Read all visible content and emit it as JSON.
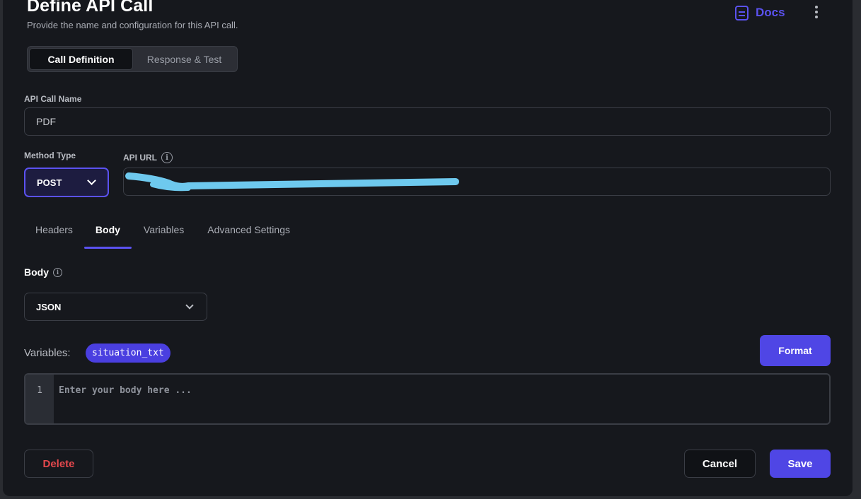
{
  "header": {
    "title": "Define API Call",
    "subtitle": "Provide the name and configuration for this API call.",
    "docs_label": "Docs",
    "docs_icon": "document-icon",
    "menu_icon": "kebab-menu-icon"
  },
  "segmented": {
    "tabs": [
      "Call Definition",
      "Response & Test"
    ],
    "active": "Call Definition"
  },
  "form": {
    "api_call_name": {
      "label": "API Call Name",
      "value": "PDF"
    },
    "method_type": {
      "label": "Method Type",
      "value": "POST"
    },
    "api_url": {
      "label": "API URL",
      "value": "",
      "info_icon": "info-icon",
      "note": "redacted by scribble"
    }
  },
  "config_tabs": {
    "items": [
      "Headers",
      "Body",
      "Variables",
      "Advanced Settings"
    ],
    "active": "Body"
  },
  "body": {
    "label": "Body",
    "type": "JSON",
    "variables_label": "Variables:",
    "variables": [
      "situation_txt"
    ],
    "format_label": "Format",
    "editor": {
      "line_number": "1",
      "placeholder": "Enter your body here ..."
    }
  },
  "footer": {
    "delete_label": "Delete",
    "cancel_label": "Cancel",
    "save_label": "Save"
  },
  "colors": {
    "accent": "#5b52f0",
    "danger": "#e5484d",
    "background": "#16181d",
    "redaction": "#6ec9ee"
  }
}
